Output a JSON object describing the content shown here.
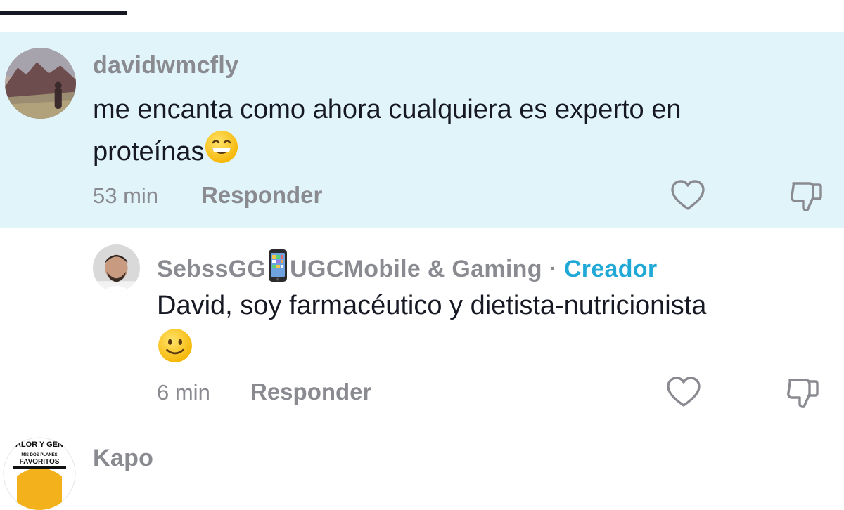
{
  "tabs": {
    "active_indicator": "active-tab-underline"
  },
  "colors": {
    "highlight_bg": "#e1f4fa",
    "muted_text": "#8a8b91",
    "creator_accent": "#20a9d6",
    "primary_text": "#161823"
  },
  "comments": [
    {
      "username": "davidwmcfly",
      "text_line1": "me encanta como ahora cualquiera es experto en",
      "text_line2": "proteínas",
      "emoji": "grinning-face-emoji",
      "time": "53 min",
      "reply_label": "Responder",
      "highlighted": true
    },
    {
      "username": "SebssGG",
      "username_suffix": "UGCMobile & Gaming",
      "name_emoji": "mobile-phone-emoji",
      "separator": "·",
      "creator_label": "Creador",
      "text_line1": "David, soy farmacéutico y dietista-nutricionista",
      "emoji": "slightly-smiling-face-emoji",
      "time": "6 min",
      "reply_label": "Responder"
    },
    {
      "username": "Kapo",
      "avatar_text_top": "ALOR Y GEN",
      "avatar_text_mid": "MIS DOS PLANES",
      "avatar_text_main": "FAVORITOS"
    }
  ],
  "icons": [
    "heart-outline-icon",
    "thumbs-down-outline-icon"
  ]
}
